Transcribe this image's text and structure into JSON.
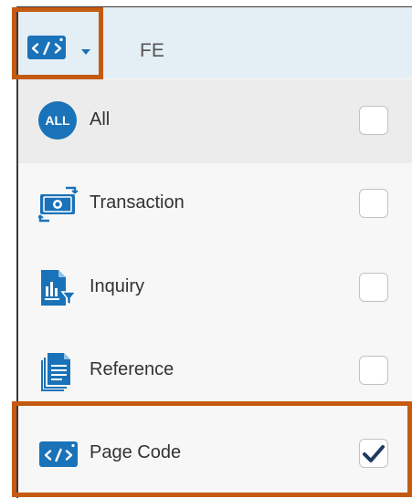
{
  "header": {
    "selected_filter": "FE",
    "trigger_icon": "page-code-icon",
    "accent_color": "#1a72b8"
  },
  "items": [
    {
      "label": "All",
      "icon": "all-icon",
      "badge_text": "ALL",
      "checked": false
    },
    {
      "label": "Transaction",
      "icon": "transaction-icon",
      "checked": false
    },
    {
      "label": "Inquiry",
      "icon": "inquiry-icon",
      "checked": false
    },
    {
      "label": "Reference",
      "icon": "reference-icon",
      "checked": false
    },
    {
      "label": "Page Code",
      "icon": "page-code-icon",
      "checked": true
    }
  ],
  "highlight_color": "#c55a11"
}
